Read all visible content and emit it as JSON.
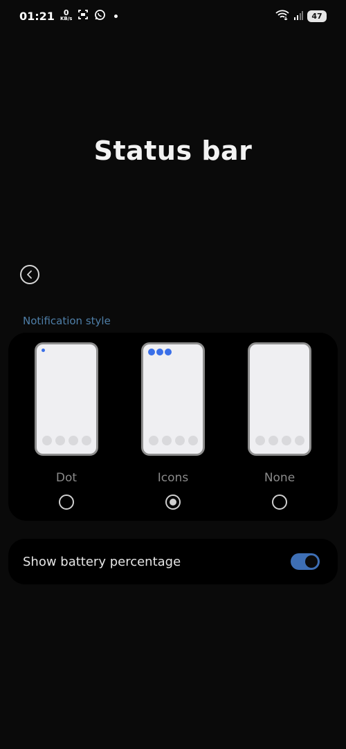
{
  "status_bar": {
    "time": "01:21",
    "net_speed_value": "0",
    "net_speed_unit": "KB/s",
    "battery_level": "47"
  },
  "page": {
    "title": "Status bar"
  },
  "notification_style": {
    "section_label": "Notification style",
    "options": [
      {
        "label": "Dot",
        "selected": false
      },
      {
        "label": "Icons",
        "selected": true
      },
      {
        "label": "None",
        "selected": false
      }
    ]
  },
  "battery_percentage": {
    "label": "Show battery percentage",
    "enabled": true
  },
  "colors": {
    "accent": "#3e6fb5",
    "section_label": "#4f7fa8",
    "notification_marker": "#3a6fe8"
  }
}
